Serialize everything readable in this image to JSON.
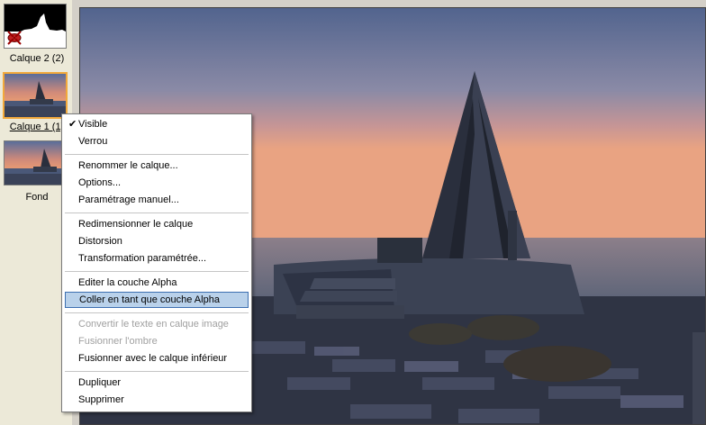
{
  "layers": [
    {
      "label": "Calque 2 (2)",
      "thumb": "histogram-mask"
    },
    {
      "label": "Calque 1 (1)",
      "thumb": "sunset-monument",
      "selected": true
    },
    {
      "label": "Fond",
      "thumb": "sunset-monument"
    }
  ],
  "menu": {
    "items": [
      {
        "label": "Visible",
        "checked": true
      },
      {
        "label": "Verrou"
      },
      {
        "label": "Renommer le calque..."
      },
      {
        "label": "Options..."
      },
      {
        "label": "Paramétrage manuel..."
      },
      {
        "label": "Redimensionner le calque"
      },
      {
        "label": "Distorsion"
      },
      {
        "label": "Transformation paramétrée..."
      },
      {
        "label": "Editer la couche Alpha"
      },
      {
        "label": "Coller en tant que couche Alpha",
        "highlighted": true
      },
      {
        "label": "Convertir le texte en calque image",
        "disabled": true
      },
      {
        "label": "Fusionner l'ombre",
        "disabled": true
      },
      {
        "label": "Fusionner avec le calque inférieur"
      },
      {
        "label": "Dupliquer"
      },
      {
        "label": "Supprimer"
      }
    ]
  },
  "icons": {
    "visible_check": "check-icon",
    "layer_hidden": "eye-crossed-icon"
  },
  "colors": {
    "selection_border": "#f2a93b",
    "menu_highlight": "#b9d1ea"
  }
}
